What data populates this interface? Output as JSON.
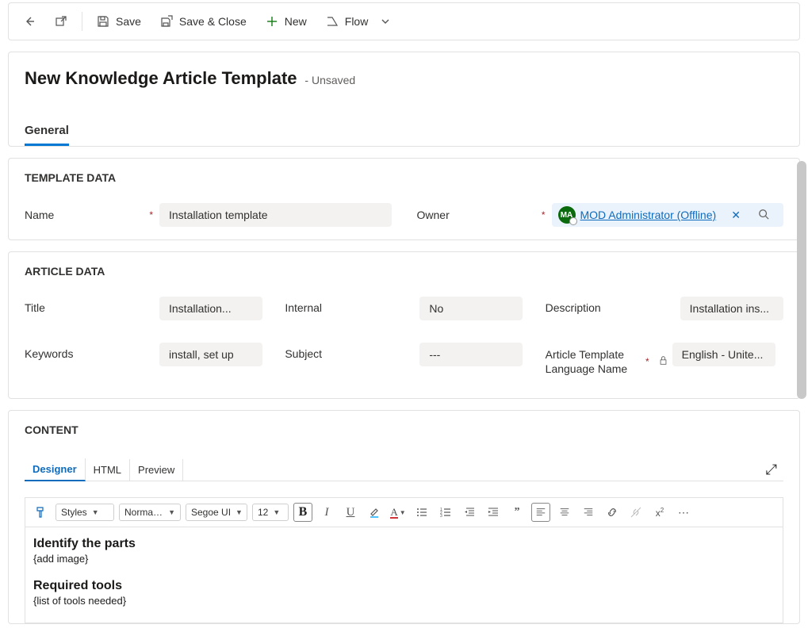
{
  "toolbar": {
    "save": "Save",
    "saveClose": "Save & Close",
    "new": "New",
    "flow": "Flow"
  },
  "header": {
    "title": "New Knowledge Article Template",
    "status": "- Unsaved",
    "tabs": [
      "General"
    ]
  },
  "templateData": {
    "sectionTitle": "TEMPLATE DATA",
    "nameLabel": "Name",
    "nameValue": "Installation template",
    "ownerLabel": "Owner",
    "ownerInitials": "MA",
    "ownerValue": "MOD Administrator (Offline)"
  },
  "articleData": {
    "sectionTitle": "ARTICLE DATA",
    "titleLabel": "Title",
    "titleValue": "Installation...",
    "internalLabel": "Internal",
    "internalValue": "No",
    "descLabel": "Description",
    "descValue": "Installation ins...",
    "keywordsLabel": "Keywords",
    "keywordsValue": "install, set up",
    "subjectLabel": "Subject",
    "subjectValue": "---",
    "langLabel": "Article Template Language Name",
    "langValue": "English - Unite..."
  },
  "content": {
    "sectionTitle": "CONTENT",
    "tabs": [
      "Designer",
      "HTML",
      "Preview"
    ],
    "rte": {
      "styles": "Styles",
      "format": "Normal (...",
      "font": "Segoe UI",
      "size": "12"
    },
    "body": {
      "h1": "Identify the parts",
      "p1": "{add image}",
      "h2": "Required tools",
      "p2": "{list of tools needed}"
    }
  }
}
